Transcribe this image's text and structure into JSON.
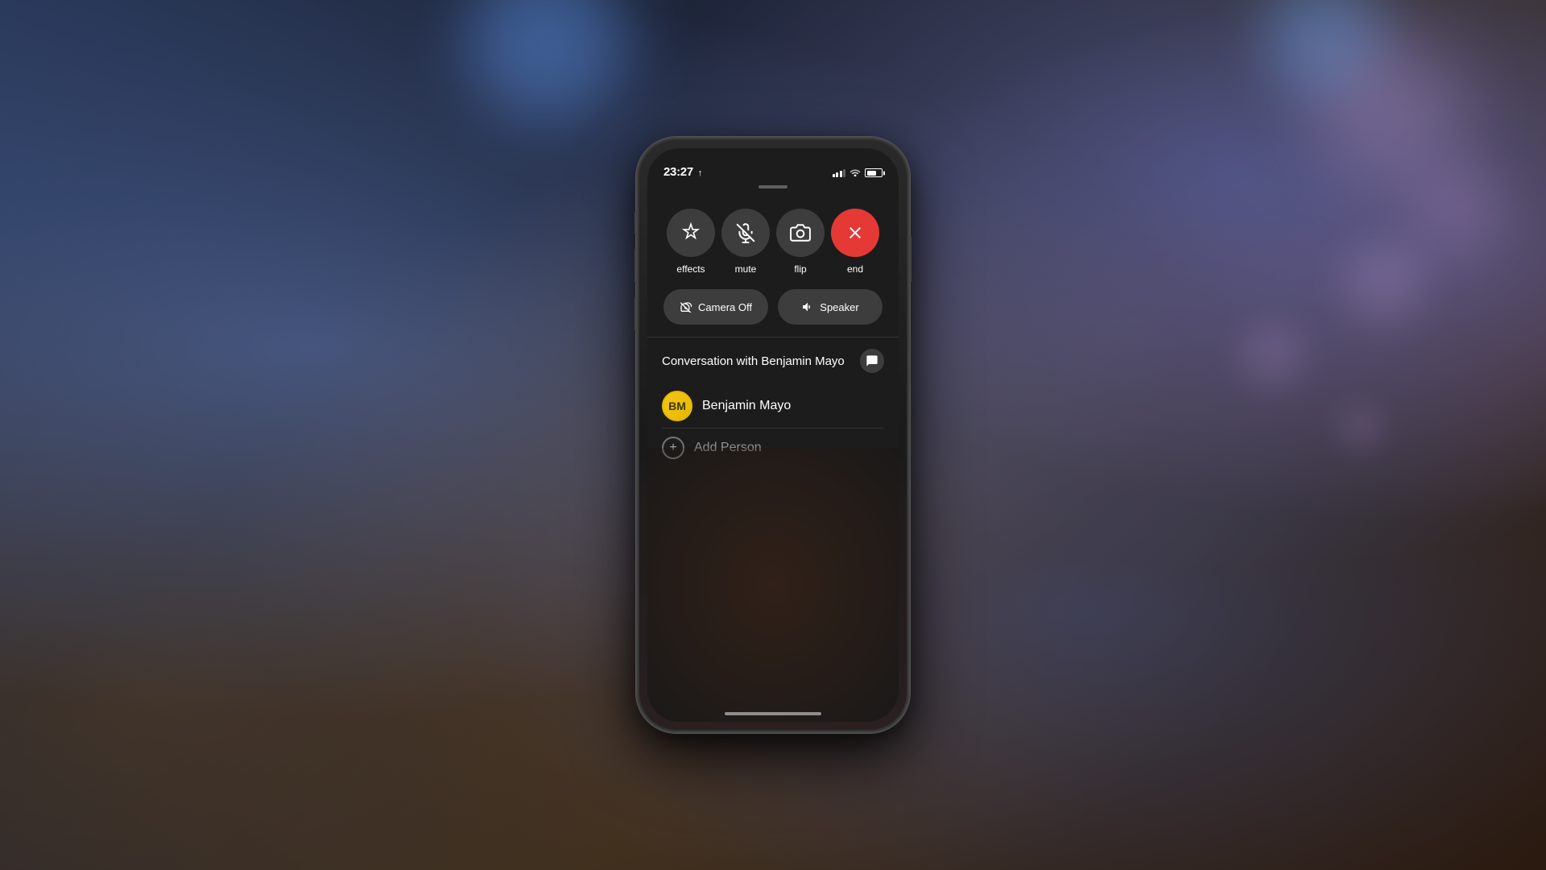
{
  "background": {
    "description": "blurred bokeh photo background with desk and shoe"
  },
  "statusBar": {
    "time": "23:27",
    "arrow": "↑",
    "signalLabel": "signal",
    "wifiLabel": "wifi",
    "batteryLabel": "battery"
  },
  "callControls": {
    "buttons": [
      {
        "id": "effects",
        "label": "effects",
        "icon": "✦",
        "type": "normal"
      },
      {
        "id": "mute",
        "label": "mute",
        "icon": "🎤",
        "type": "normal"
      },
      {
        "id": "flip",
        "label": "flip",
        "icon": "📷",
        "type": "normal"
      },
      {
        "id": "end",
        "label": "end",
        "icon": "✕",
        "type": "end"
      }
    ],
    "secondaryButtons": [
      {
        "id": "camera-off",
        "label": "Camera Off",
        "icon": "📷"
      },
      {
        "id": "speaker",
        "label": "Speaker",
        "icon": "🔊"
      }
    ]
  },
  "conversation": {
    "title": "Conversation with Benjamin Mayo",
    "messageIconLabel": "message",
    "contact": {
      "initials": "BM",
      "name": "Benjamin Mayo"
    },
    "addPerson": {
      "label": "Add Person",
      "icon": "+"
    }
  },
  "homeIndicator": "home-indicator"
}
